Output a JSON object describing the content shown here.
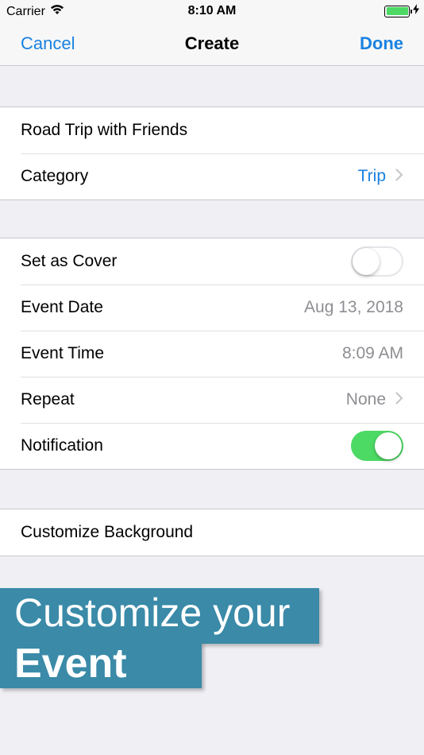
{
  "status_bar": {
    "carrier": "Carrier",
    "time": "8:10 AM",
    "wifi_icon": "wifi-icon",
    "battery_icon": "battery-icon",
    "charging_icon": "bolt-icon",
    "battery_level": 1.0
  },
  "nav": {
    "cancel_label": "Cancel",
    "title": "Create",
    "done_label": "Done"
  },
  "group1": {
    "event_name": "Road Trip with Friends",
    "category_label": "Category",
    "category_value": "Trip"
  },
  "group2": {
    "cover_label": "Set as Cover",
    "cover_on": false,
    "date_label": "Event Date",
    "date_value": "Aug 13, 2018",
    "time_label": "Event Time",
    "time_value": "8:09 AM",
    "repeat_label": "Repeat",
    "repeat_value": "None",
    "notification_label": "Notification",
    "notification_on": true
  },
  "group3": {
    "background_label": "Customize Background"
  },
  "promo": {
    "line1": "Customize your",
    "line2": "Event"
  },
  "colors": {
    "accent": "#1a82e0",
    "toggle_on": "#4cd964",
    "banner": "#3a8aa8",
    "background": "#efeff4"
  }
}
